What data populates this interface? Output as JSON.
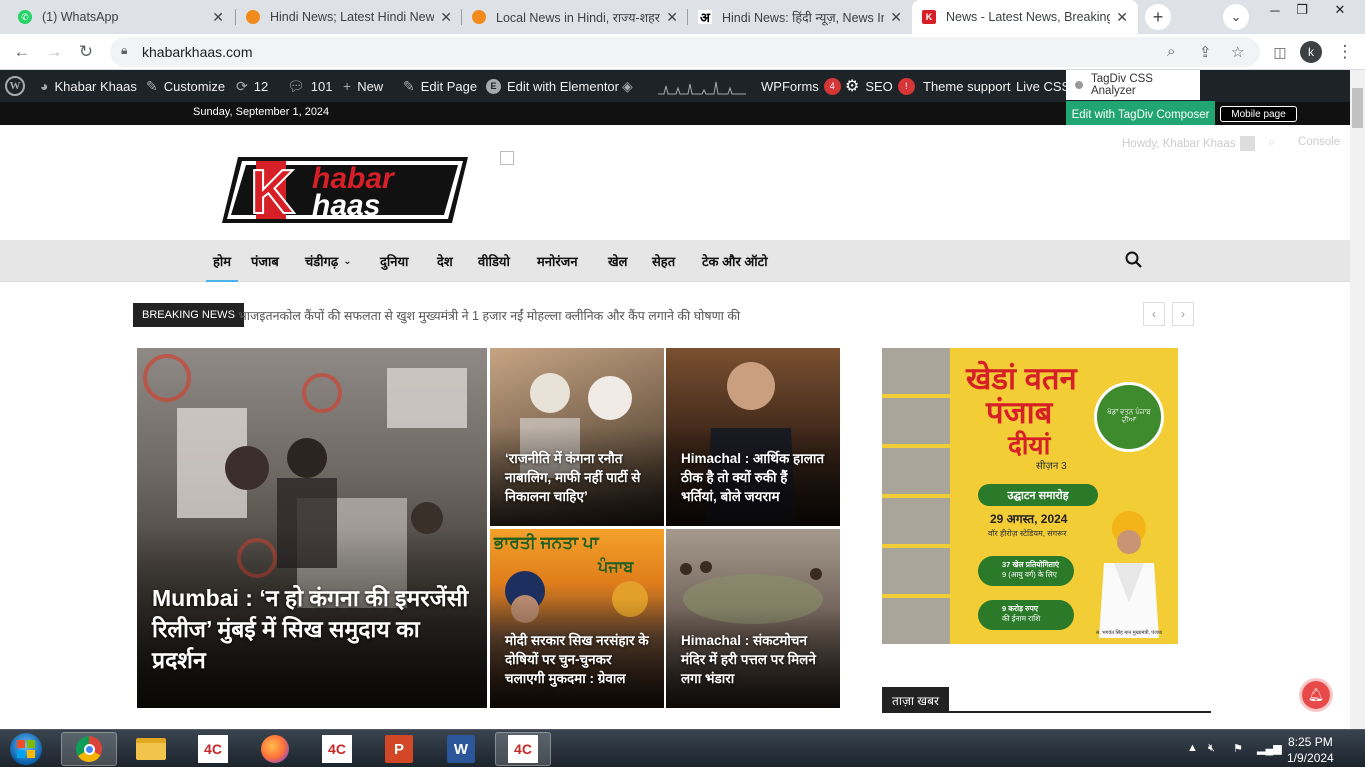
{
  "browser": {
    "tabs": [
      {
        "title": "(1) WhatsApp",
        "icon": "whatsapp-icon",
        "color": "#25d366"
      },
      {
        "title": "Hindi News; Latest Hindi News",
        "icon": "orange-circle-icon",
        "color": "#f28a1c"
      },
      {
        "title": "Local News in Hindi, राज्य-शहर",
        "icon": "orange-circle-icon",
        "color": "#f28a1c"
      },
      {
        "title": "Hindi News: हिंदी न्यूज़, News In",
        "icon": "amar-ujala-icon",
        "color": "#000000"
      },
      {
        "title": "News - Latest News, Breaking",
        "icon": "khabar-khaas-icon",
        "color": "#d61f26"
      }
    ],
    "url": "khabarkhaas.com",
    "profile": "k"
  },
  "wp_admin": {
    "site_name": "Khabar Khaas",
    "customize": "Customize",
    "updates": "12",
    "comments": "101",
    "new": "New",
    "edit_page": "Edit Page",
    "elementor": "Edit with Elementor",
    "wpforms": "WPForms",
    "wpforms_badge": "4",
    "seo": "SEO",
    "seo_badge": "!",
    "theme_support": "Theme support",
    "live_css": "Live CSS",
    "tagdiv_css": "TagDiv CSS Analyzer",
    "tagdiv_composer": "Edit with TagDiv Composer",
    "mobile_page": "Mobile page"
  },
  "site": {
    "date": "Sunday, September 1, 2024",
    "howdy": "Howdy, Khabar Khaas",
    "console": "Console",
    "logo_line1": "habar",
    "logo_line2": "haas",
    "logo_k": "K"
  },
  "nav": {
    "items": [
      "होम",
      "पंजाब",
      "चंडीगढ़",
      "दुनिया",
      "देश",
      "वीडियो",
      "मनोरंजन",
      "खेल",
      "सेहत",
      "टेक और ऑटो"
    ],
    "chandigarh_dropdown": "⌄"
  },
  "breaking": {
    "label": "BREAKING NEWS",
    "text1": "भाजइतनकोल कैंपों की सफलता से खुश मुख्यमंत्री ने 1 हजार नईं मोहल्ला क्लीनिक और कैंप लगाने की घोषणा की",
    "prev": "‹",
    "next": "›"
  },
  "grid": {
    "big": "Mumbai : ‘न हो कंगना की इमरजेंसी रिलीज’ मुंबई में सिख समुदाय का प्रदर्शन",
    "s1": "‘राजनीति में कंगना रनौत नाबालिग, माफी नहीं पार्टी से निकालना चाहिए’",
    "s2": "Himachal : आर्थिक हालात ठीक है तो क्यों रुकी हैं भर्तियां, बोले जयराम",
    "s3": "मोदी सरकार सिख नरसंहार के दोषियों पर चुन-चुनकर चलाएगी मुकदमा : ग्रेवाल",
    "s4": "Himachal : संकटमोचन मंदिर में हरी पत्तल पर मिलने लगा भंडारा",
    "s3_banner": "ਭਾਰਤੀ ਜਨਤਾ ਪਾ",
    "s3_banner2": "ਪੰਜਾਬ"
  },
  "ad": {
    "title1": "खेडां वतन",
    "title2": "पंजाब",
    "title3": "दीयां",
    "season": "सीज़न 3",
    "event": "उद्घाटन समारोह",
    "date": "29 अगस्त, 2024",
    "venue": "वॉर हीरोज़ स्टेडियम, संगरूर",
    "games": "37 खेल प्रतियोगिताएं",
    "games_sub": "9 (आयु वर्ग) के लिए",
    "prize": "9 करोड़ रुपए",
    "prize_sub": "की ईनाम राशि",
    "emblem": "ਖੇਡਾਂ ਵਤਨ ਪੰਜਾਬ ਦੀਆਂ",
    "person": "स. भगवंत सिंह मान मुख्यमंत्री, पंजाब"
  },
  "sidebar": {
    "latest": "ताज़ा खबर"
  },
  "taskbar": {
    "apps": [
      "chrome-icon",
      "folder-icon",
      "4c-icon",
      "firefox-icon",
      "4c-icon",
      "powerpoint-icon",
      "word-icon",
      "4c-icon"
    ],
    "time": "8:25 PM",
    "date": "1/9/2024"
  },
  "colors": {
    "accent": "#4db2ec",
    "brand_red": "#d61f26",
    "tagdiv_green": "#21a573",
    "wp_dark": "#1d2327"
  }
}
